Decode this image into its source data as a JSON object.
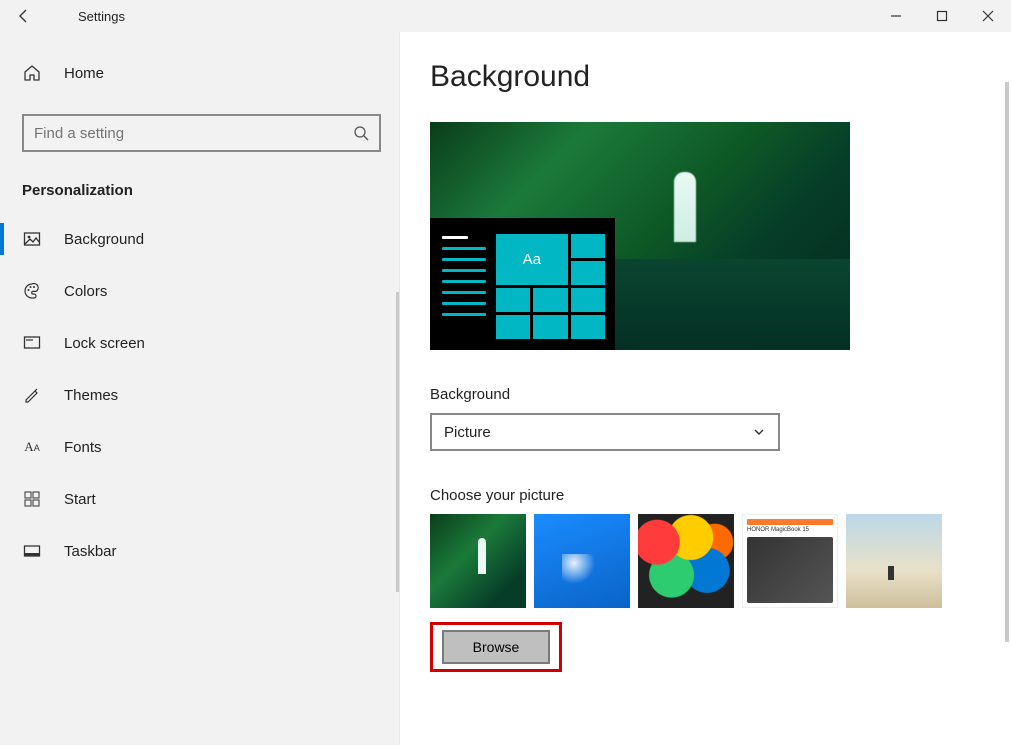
{
  "window": {
    "title": "Settings"
  },
  "sidebar": {
    "home_label": "Home",
    "search_placeholder": "Find a setting",
    "category": "Personalization",
    "items": [
      {
        "id": "background",
        "label": "Background",
        "selected": true
      },
      {
        "id": "colors",
        "label": "Colors",
        "selected": false
      },
      {
        "id": "lockscreen",
        "label": "Lock screen",
        "selected": false
      },
      {
        "id": "themes",
        "label": "Themes",
        "selected": false
      },
      {
        "id": "fonts",
        "label": "Fonts",
        "selected": false
      },
      {
        "id": "start",
        "label": "Start",
        "selected": false
      },
      {
        "id": "taskbar",
        "label": "Taskbar",
        "selected": false
      }
    ]
  },
  "main": {
    "page_title": "Background",
    "preview_sample_text": "Aa",
    "bg_label": "Background",
    "bg_value": "Picture",
    "choose_label": "Choose your picture",
    "browse_label": "Browse"
  },
  "colors": {
    "accent": "#0078d4",
    "tile": "#00b7c3",
    "highlight_annotation": "#d40000"
  }
}
